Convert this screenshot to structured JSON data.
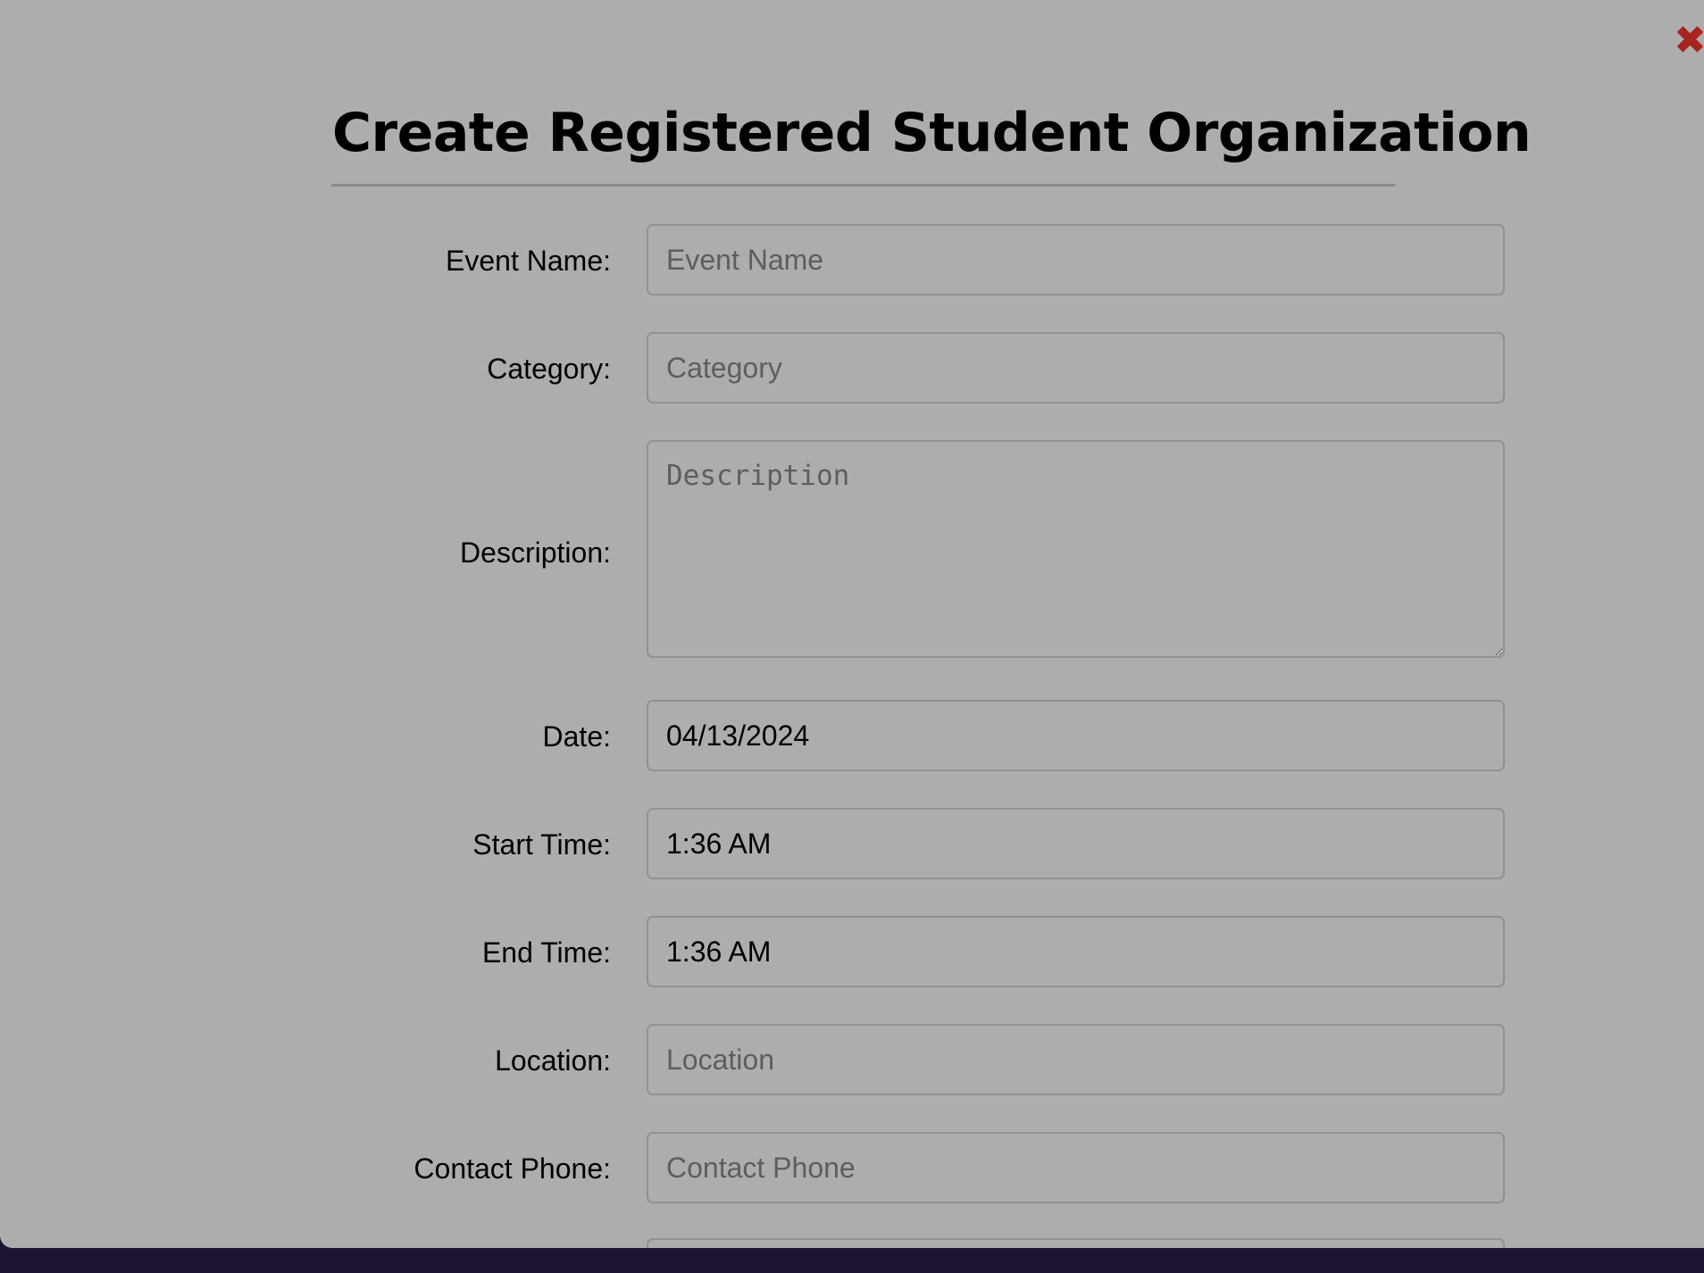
{
  "modal": {
    "title": "Create Registered Student Organization",
    "close_icon": "close-icon",
    "close_glyph": "✖",
    "accent_close": "#a8241f"
  },
  "form": {
    "event_name": {
      "label": "Event Name:",
      "placeholder": "Event Name",
      "value": ""
    },
    "category": {
      "label": "Category:",
      "placeholder": "Category",
      "value": ""
    },
    "description": {
      "label": "Description:",
      "placeholder": "Description",
      "value": ""
    },
    "date": {
      "label": "Date:",
      "placeholder": "",
      "value": "04/13/2024"
    },
    "start_time": {
      "label": "Start Time:",
      "placeholder": "",
      "value": "1:36 AM"
    },
    "end_time": {
      "label": "End Time:",
      "placeholder": "",
      "value": "1:36 AM"
    },
    "location": {
      "label": "Location:",
      "placeholder": "Location",
      "value": ""
    },
    "contact_phone": {
      "label": "Contact Phone:",
      "placeholder": "Contact Phone",
      "value": ""
    }
  }
}
